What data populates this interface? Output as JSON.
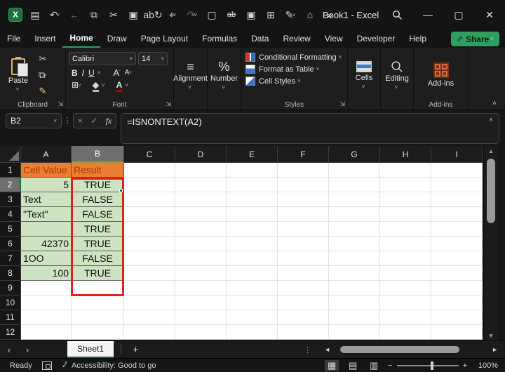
{
  "titlebar": {
    "title": "Book1 - Excel",
    "qat": [
      {
        "name": "excel-logo",
        "glyph": "X",
        "kind": "logo"
      },
      {
        "name": "save-icon",
        "glyph": "▤"
      },
      {
        "name": "undo-icon",
        "glyph": "↶",
        "chevron": true
      },
      {
        "name": "back-icon",
        "glyph": "←",
        "dim": true
      },
      {
        "name": "copy-icon",
        "glyph": "⧉"
      },
      {
        "name": "cut-icon",
        "glyph": "✂"
      },
      {
        "name": "paste-picture-icon",
        "glyph": "▣"
      },
      {
        "name": "spelling-icon",
        "glyph": "ab↻"
      },
      {
        "name": "touch-mode-icon",
        "glyph": "⌖",
        "chevron": true
      },
      {
        "name": "redo-icon",
        "glyph": "↷",
        "dim": true,
        "chevron": true
      },
      {
        "name": "new-file-icon",
        "glyph": "▢"
      },
      {
        "name": "strikethrough-icon",
        "glyph": "ab",
        "strike": true
      },
      {
        "name": "camera-icon",
        "glyph": "▣"
      },
      {
        "name": "print-preview-icon",
        "glyph": "⊞"
      },
      {
        "name": "edit-export-icon",
        "glyph": "✎",
        "chevron": true
      },
      {
        "name": "protect-find-icon",
        "glyph": "⌂"
      },
      {
        "name": "more-commands-icon",
        "glyph": "»"
      }
    ],
    "controls": {
      "search": "⌕",
      "minimize": "—",
      "maximize": "□",
      "close": "✕"
    }
  },
  "ribbon": {
    "tabs": [
      "File",
      "Insert",
      "Home",
      "Draw",
      "Page Layout",
      "Formulas",
      "Data",
      "Review",
      "View",
      "Developer",
      "Help"
    ],
    "active_tab": "Home",
    "share_label": "Share",
    "clipboard": {
      "paste_label": "Paste",
      "group_label": "Clipboard"
    },
    "font": {
      "font_name": "Calibri",
      "font_size": "14",
      "group_label": "Font",
      "bold": "B",
      "italic": "I",
      "underline": "U",
      "grow": "A",
      "shrink": "A"
    },
    "alignment": {
      "label": "Alignment"
    },
    "number": {
      "label": "Number",
      "glyph": "%"
    },
    "styles": {
      "items": [
        "Conditional Formatting",
        "Format as Table",
        "Cell Styles"
      ],
      "group_label": "Styles"
    },
    "cells": {
      "label": "Cells"
    },
    "editing": {
      "label": "Editing"
    },
    "addins": {
      "button_label": "Add-ins",
      "group_label": "Add-ins"
    }
  },
  "formula_bar": {
    "name_box": "B2",
    "cancel": "×",
    "enter": "✓",
    "fx": "fx",
    "formula": "=ISNONTEXT(A2)"
  },
  "grid": {
    "columns": [
      "A",
      "B",
      "C",
      "D",
      "E",
      "F",
      "G",
      "H",
      "I"
    ],
    "selected_column": "B",
    "selected_row": "2",
    "active_cell": "B2",
    "rows": [
      {
        "n": "1",
        "a": "Cell Value",
        "b": "Result",
        "style": "header"
      },
      {
        "n": "2",
        "a": "5",
        "a_align": "right",
        "b": "TRUE",
        "style": "data"
      },
      {
        "n": "3",
        "a": "Text",
        "a_align": "left",
        "b": "FALSE",
        "style": "data"
      },
      {
        "n": "4",
        "a": "\"Text\"",
        "a_align": "left",
        "b": "FALSE",
        "style": "data"
      },
      {
        "n": "5",
        "a": "",
        "a_align": "left",
        "b": "TRUE",
        "style": "data"
      },
      {
        "n": "6",
        "a": "42370",
        "a_align": "right",
        "b": "TRUE",
        "style": "data"
      },
      {
        "n": "7",
        "a": "1OO",
        "a_align": "left",
        "b": "FALSE",
        "style": "data"
      },
      {
        "n": "8",
        "a": "100",
        "a_align": "right",
        "b": "TRUE",
        "style": "data"
      },
      {
        "n": "9"
      },
      {
        "n": "10"
      },
      {
        "n": "11"
      },
      {
        "n": "12"
      }
    ]
  },
  "sheet_bar": {
    "prev": "‹",
    "next": "›",
    "tab": "Sheet1",
    "add": "+"
  },
  "status_bar": {
    "ready": "Ready",
    "accessibility": "Accessibility: Good to go",
    "views": [
      {
        "name": "normal-view-icon",
        "glyph": "▦"
      },
      {
        "name": "page-layout-view-icon",
        "glyph": "▤"
      },
      {
        "name": "page-break-view-icon",
        "glyph": "▥"
      }
    ],
    "zoom_out": "−",
    "zoom_in": "+",
    "zoom_level": "100%"
  },
  "colors": {
    "header_fill": "#ED7D31",
    "header_text": "#9C3A0E",
    "data_fill": "#CDE3C1",
    "highlight_border": "#DF231B",
    "excel_green": "#2F9E5F"
  }
}
